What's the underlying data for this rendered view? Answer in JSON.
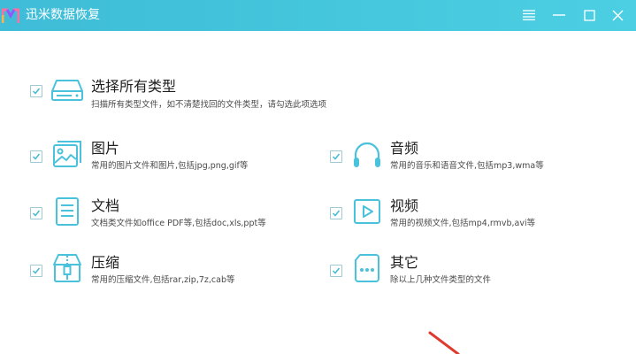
{
  "app": {
    "title": "迅米数据恢复",
    "accent_color": "#46c6dd",
    "logo_icon": "m-logo-icon"
  },
  "window_controls": [
    "menu-icon",
    "minimize-icon",
    "maximize-icon",
    "close-icon"
  ],
  "select_all": {
    "checked": true,
    "icon": "drive-icon",
    "title": "选择所有类型",
    "description": "扫描所有类型文件，如不清楚找回的文件类型，请勾选此项选项"
  },
  "categories": {
    "pictures": {
      "checked": true,
      "icon": "picture-icon",
      "title": "图片",
      "description": "常用的图片文件和图片,包括jpg,png,gif等"
    },
    "audio": {
      "checked": true,
      "icon": "headphones-icon",
      "title": "音频",
      "description": "常用的音乐和语音文件,包括mp3,wma等"
    },
    "documents": {
      "checked": true,
      "icon": "document-icon",
      "title": "文档",
      "description": "文档类文件如office PDF等,包括doc,xls,ppt等"
    },
    "video": {
      "checked": true,
      "icon": "video-icon",
      "title": "视频",
      "description": "常用的视频文件,包括mp4,rmvb,avi等"
    },
    "archives": {
      "checked": true,
      "icon": "archive-icon",
      "title": "压缩",
      "description": "常用的压缩文件,包括rar,zip,7z,cab等"
    },
    "other": {
      "checked": true,
      "icon": "more-icon",
      "title": "其它",
      "description": "除以上几种文件类型的文件"
    }
  }
}
